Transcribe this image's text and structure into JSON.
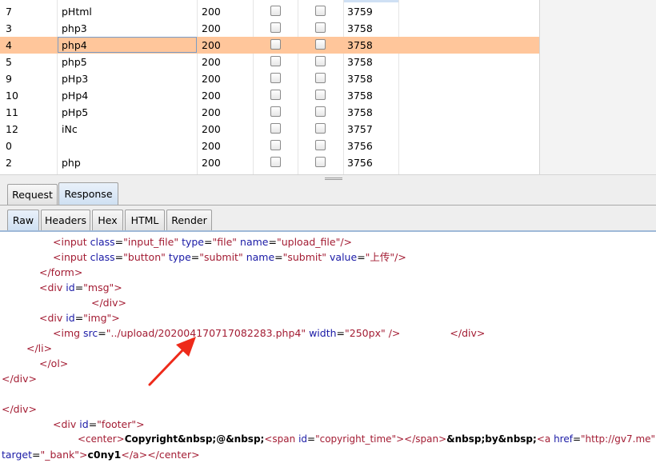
{
  "results": {
    "rows": [
      {
        "num": "7",
        "payload": "pHtml",
        "status": "200",
        "length": "3759",
        "selected": false
      },
      {
        "num": "3",
        "payload": "php3",
        "status": "200",
        "length": "3758",
        "selected": false
      },
      {
        "num": "4",
        "payload": "php4",
        "status": "200",
        "length": "3758",
        "selected": true
      },
      {
        "num": "5",
        "payload": "php5",
        "status": "200",
        "length": "3758",
        "selected": false
      },
      {
        "num": "9",
        "payload": "pHp3",
        "status": "200",
        "length": "3758",
        "selected": false
      },
      {
        "num": "10",
        "payload": "pHp4",
        "status": "200",
        "length": "3758",
        "selected": false
      },
      {
        "num": "11",
        "payload": "pHp5",
        "status": "200",
        "length": "3758",
        "selected": false
      },
      {
        "num": "12",
        "payload": "iNc",
        "status": "200",
        "length": "3757",
        "selected": false
      },
      {
        "num": "0",
        "payload": "",
        "status": "200",
        "length": "3756",
        "selected": false
      },
      {
        "num": "2",
        "payload": "php",
        "status": "200",
        "length": "3756",
        "selected": false
      }
    ]
  },
  "tabs": {
    "request": "Request",
    "response": "Response",
    "active": "Response"
  },
  "subtabs": {
    "raw": "Raw",
    "headers": "Headers",
    "hex": "Hex",
    "html": "HTML",
    "render": "Render",
    "active": "Raw"
  },
  "code": {
    "l1": {
      "t1": "<input",
      "a1": "class",
      "e1": "=",
      "v1": "\"input_file\"",
      "a2": "type",
      "e2": "=",
      "v2": "\"file\"",
      "a3": "name",
      "e3": "=",
      "v3": "\"upload_file\"",
      "t2": "/>"
    },
    "l2": {
      "t1": "<input",
      "a1": "class",
      "e1": "=",
      "v1": "\"button\"",
      "a2": "type",
      "e2": "=",
      "v2": "\"submit\"",
      "a3": "name",
      "e3": "=",
      "v3": "\"submit\"",
      "a4": "value",
      "e4": "=",
      "v4": "\"上传\"",
      "t2": "/>"
    },
    "l3": {
      "t1": "</form>"
    },
    "l4": {
      "t1": "<div",
      "a1": "id",
      "e1": "=",
      "v1": "\"msg\"",
      "t2": ">"
    },
    "l5": {
      "t1": "</div>"
    },
    "l6": {
      "t1": "<div",
      "a1": "id",
      "e1": "=",
      "v1": "\"img\"",
      "t2": ">"
    },
    "l7": {
      "t1": "<img",
      "a1": "src",
      "e1": "=",
      "v1": "\"../upload/202004170717082283.php4\"",
      "a2": "width",
      "e2": "=",
      "v2": "\"250px\"",
      "t2": "/>",
      "t3": "</div>"
    },
    "l8": {
      "t1": "</li>"
    },
    "l9": {
      "t1": "</ol>"
    },
    "l10": {
      "t1": "</div>"
    },
    "l11": {
      "t1": "</div>"
    },
    "l12": {
      "t1": "<div",
      "a1": "id",
      "e1": "=",
      "v1": "\"footer\"",
      "t2": ">"
    },
    "l13": {
      "t1": "<center>",
      "b1": "Copyright&nbsp;@&nbsp;",
      "t2": "<span",
      "a1": "id",
      "e1": "=",
      "v1": "\"copyright_time\"",
      "t3": ">",
      "t4": "</span>",
      "b2": "&nbsp;by&nbsp;",
      "t5": "<a",
      "a2": "href",
      "e2": "=",
      "v2": "\"http://gv7.me\""
    },
    "l14": {
      "a1": "target",
      "e1": "=",
      "v1": "\"_bank\"",
      "t1": ">",
      "b1": "c0ny1",
      "t2": "</a>",
      "t3": "</center>"
    }
  },
  "colors": {
    "selected_row": "#ffc69b",
    "tag": "#a31c33",
    "attribute": "#1a1aa6",
    "arrow": "#ee2a1a"
  }
}
